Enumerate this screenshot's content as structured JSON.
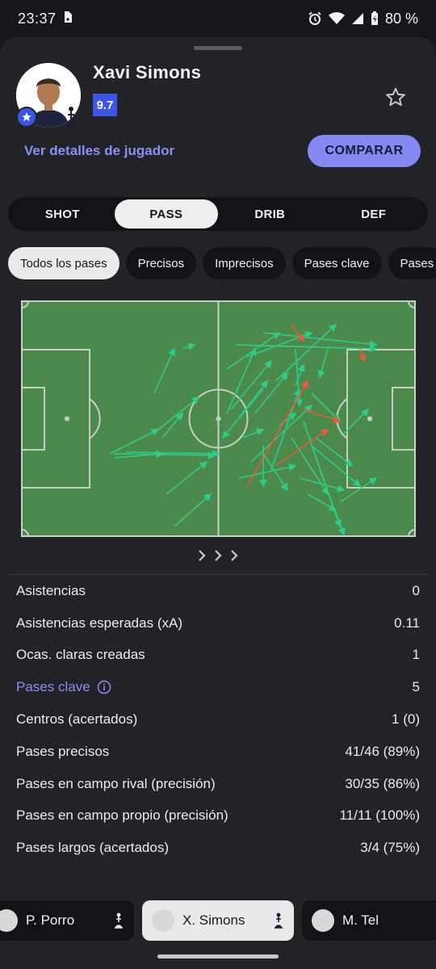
{
  "status_bar": {
    "time": "23:37",
    "battery": "80 %"
  },
  "player": {
    "name": "Xavi Simons",
    "rating": "9.7"
  },
  "actions": {
    "details_link": "Ver detalles de jugador",
    "compare_label": "COMPARAR"
  },
  "tabs": [
    {
      "label": "SHOT",
      "active": false
    },
    {
      "label": "PASS",
      "active": true
    },
    {
      "label": "DRIB",
      "active": false
    },
    {
      "label": "DEF",
      "active": false
    }
  ],
  "filters": [
    {
      "label": "Todos los pases",
      "active": true
    },
    {
      "label": "Precisos",
      "active": false
    },
    {
      "label": "Imprecisos",
      "active": false
    },
    {
      "label": "Pases clave",
      "active": false
    },
    {
      "label": "Pases",
      "active": false
    }
  ],
  "pitch_colors": {
    "grass": "#4b8a4a",
    "lines": "#c6d0c6",
    "accurate_pass": "#2ecc8a",
    "inaccurate_pass": "#ec5a3c"
  },
  "stats": [
    {
      "label": "Asistencias",
      "value": "0"
    },
    {
      "label": "Asistencias esperadas (xA)",
      "value": "0.11"
    },
    {
      "label": "Ocas. claras creadas",
      "value": "1"
    },
    {
      "label": "Pases clave",
      "value": "5",
      "highlight": true,
      "info_icon": "info-icon"
    },
    {
      "label": "Centros (acertados)",
      "value": "1 (0)"
    },
    {
      "label": "Pases precisos",
      "value": "41/46 (89%)"
    },
    {
      "label": "Pases en campo rival (precisión)",
      "value": "30/35 (86%)"
    },
    {
      "label": "Pases en campo propio (precisión)",
      "value": "11/11 (100%)"
    },
    {
      "label": "Pases largos (acertados)",
      "value": "3/4 (75%)"
    }
  ],
  "player_strip": [
    {
      "name": "P. Porro",
      "active": false
    },
    {
      "name": "X. Simons",
      "active": true
    },
    {
      "name": "M. Tel",
      "active": false
    }
  ]
}
